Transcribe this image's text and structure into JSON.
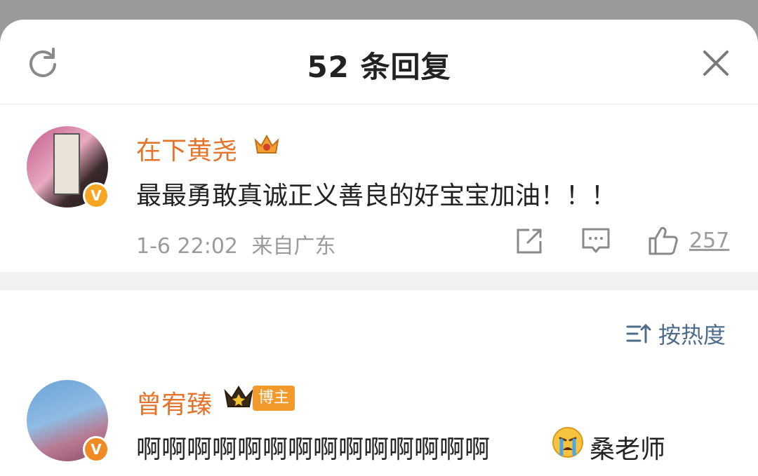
{
  "header": {
    "title": "52 条回复"
  },
  "main_comment": {
    "username": "在下黄尧",
    "text": "最最勇敢真诚正义善良的好宝宝加油！！！",
    "time": "1-6 22:02",
    "location": "来自广东",
    "like_count": "257"
  },
  "sort": {
    "label": "按热度"
  },
  "reply": {
    "username": "曾宥臻",
    "tag": "博主",
    "text": "啊啊啊啊啊啊啊啊啊啊啊啊啊啊",
    "text_after": "桑老师"
  },
  "colors": {
    "name": "#e3742b",
    "sort": "#4e6c8a",
    "badge": "#f39a2c"
  },
  "icons": [
    "refresh-icon",
    "close-icon",
    "share-icon",
    "comment-icon",
    "like-icon",
    "sort-icon",
    "crown-icon",
    "verified-icon",
    "crying-emoji"
  ]
}
